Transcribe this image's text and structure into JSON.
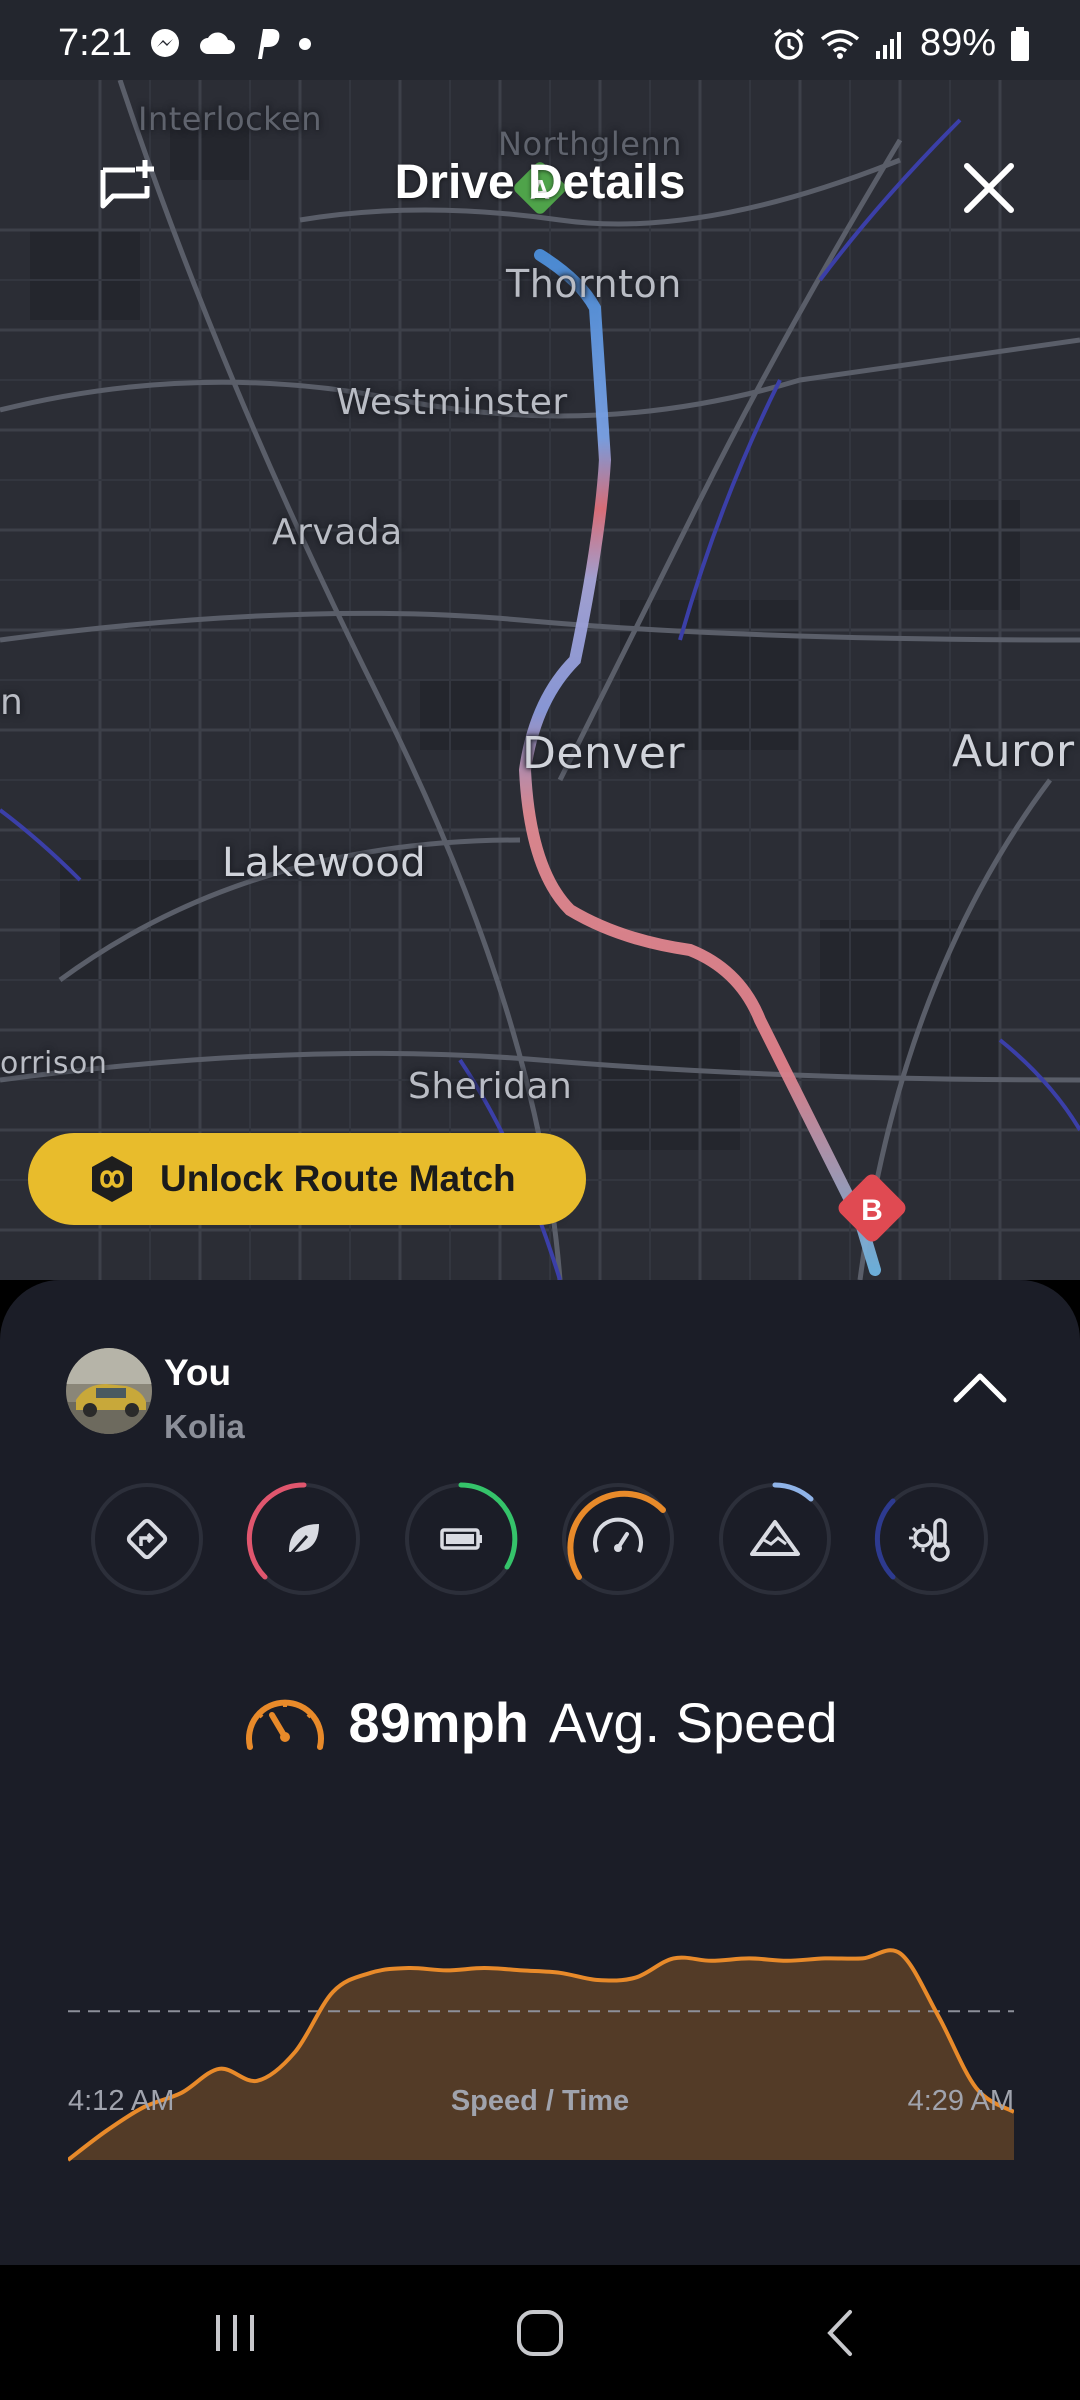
{
  "status_bar": {
    "time": "7:21",
    "battery": "89%",
    "left_icons": [
      "messenger-icon",
      "cloud-icon",
      "paypal-icon",
      "dot-icon"
    ],
    "right_icons": [
      "alarm-icon",
      "wifi-icon",
      "signal-icon",
      "battery-icon"
    ]
  },
  "header": {
    "title": "Drive Details",
    "left_icon": "add-comment-icon",
    "right_icon": "close-icon"
  },
  "map": {
    "cities": {
      "interlocken": "Interlocken",
      "northglenn": "Northglenn",
      "thornton": "Thornton",
      "westminster": "Westminster",
      "arvada": "Arvada",
      "denver": "Denver",
      "aurora": "Auror",
      "lakewood": "Lakewood",
      "morrison": "orrison",
      "sheridan": "Sheridan",
      "left_edge": "n",
      "hidden": "n"
    },
    "start_marker": "A",
    "end_marker": "B",
    "unlock_button": "Unlock Route Match"
  },
  "sheet": {
    "user_name": "You",
    "user_sub": "Kolia",
    "metrics": [
      {
        "name": "route-icon",
        "color": "#5a5f6e",
        "level": 0
      },
      {
        "name": "eco-leaf-icon",
        "color": "#e0566e",
        "level": 0.4
      },
      {
        "name": "battery-icon",
        "color": "#35c36a",
        "level": 0.3
      },
      {
        "name": "speedometer-icon",
        "color": "#e88a2a",
        "level": 0.55,
        "active": true
      },
      {
        "name": "elevation-icon",
        "color": "#8fb3e8",
        "level": 0.15
      },
      {
        "name": "temperature-icon",
        "color": "#2d3a8f",
        "level": 0.3
      }
    ],
    "speed_value": "89mph",
    "speed_label": "Avg. Speed",
    "colors": {
      "accent": "#e88a2a",
      "sheet_bg": "#1b1d27"
    }
  },
  "chart_data": {
    "type": "area",
    "title": "Speed / Time",
    "x_start": "4:12 AM",
    "x_end": "4:29 AM",
    "reference_line": "average",
    "values": [
      0,
      12,
      22,
      28,
      38,
      33,
      45,
      70,
      78,
      80,
      79,
      80,
      79,
      78,
      75,
      76,
      84,
      83,
      84,
      83,
      84,
      84,
      86,
      60,
      30,
      20
    ]
  }
}
